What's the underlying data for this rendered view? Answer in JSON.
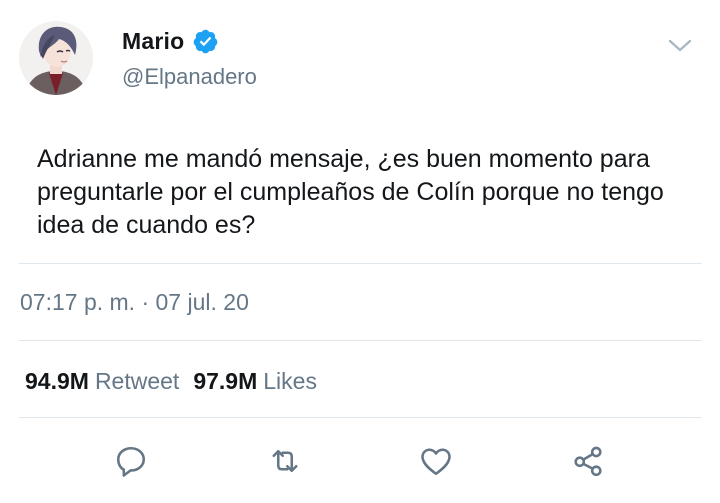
{
  "author": {
    "name": "Mario",
    "handle": "@Elpanadero",
    "verified": true,
    "verified_color": "#1da1f2"
  },
  "tweet": {
    "text": "Adrianne me mandó mensaje, ¿es buen momento para preguntarle por el cumpleaños de Colín porque no tengo idea de cuando es?",
    "timestamp": "07:17 p. m. · 07 jul. 20"
  },
  "stats": {
    "retweets_count": "94.9M",
    "retweets_label": "Retweet",
    "likes_count": "97.9M",
    "likes_label": "Likes"
  },
  "actions": [
    "reply-icon",
    "retweet-icon",
    "like-icon",
    "share-icon"
  ],
  "colors": {
    "text": "#14171a",
    "secondary": "#657786",
    "divider": "#e1e8ed"
  }
}
